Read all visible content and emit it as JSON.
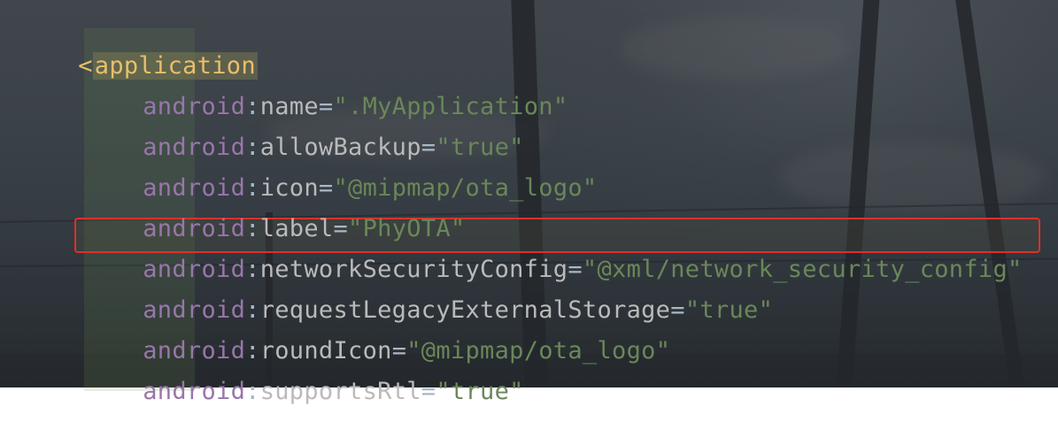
{
  "editor": {
    "tag_open_bracket": "<",
    "tag_name": "application",
    "attributes": [
      {
        "ns": "android",
        "colon": ":",
        "name": "name",
        "eq": "=",
        "value": "\".MyApplication\""
      },
      {
        "ns": "android",
        "colon": ":",
        "name": "allowBackup",
        "eq": "=",
        "value": "\"true\""
      },
      {
        "ns": "android",
        "colon": ":",
        "name": "icon",
        "eq": "=",
        "value": "\"@mipmap/ota_logo\""
      },
      {
        "ns": "android",
        "colon": ":",
        "name": "label",
        "eq": "=",
        "value": "\"PhyOTA\""
      },
      {
        "ns": "android",
        "colon": ":",
        "name": "networkSecurityConfig",
        "eq": "=",
        "value": "\"@xml/network_security_config\""
      },
      {
        "ns": "android",
        "colon": ":",
        "name": "requestLegacyExternalStorage",
        "eq": "=",
        "value": "\"true\""
      },
      {
        "ns": "android",
        "colon": ":",
        "name": "roundIcon",
        "eq": "=",
        "value": "\"@mipmap/ota_logo\""
      },
      {
        "ns": "android",
        "colon": ":",
        "name": "supportsRtl",
        "eq": "=",
        "value": "\"true\""
      }
    ],
    "highlighted_index": 4
  },
  "colors": {
    "tag": "#e8bf6a",
    "namespace": "#9876aa",
    "attribute": "#bababa",
    "value": "#6a8759",
    "highlight_border": "#d9322b"
  }
}
